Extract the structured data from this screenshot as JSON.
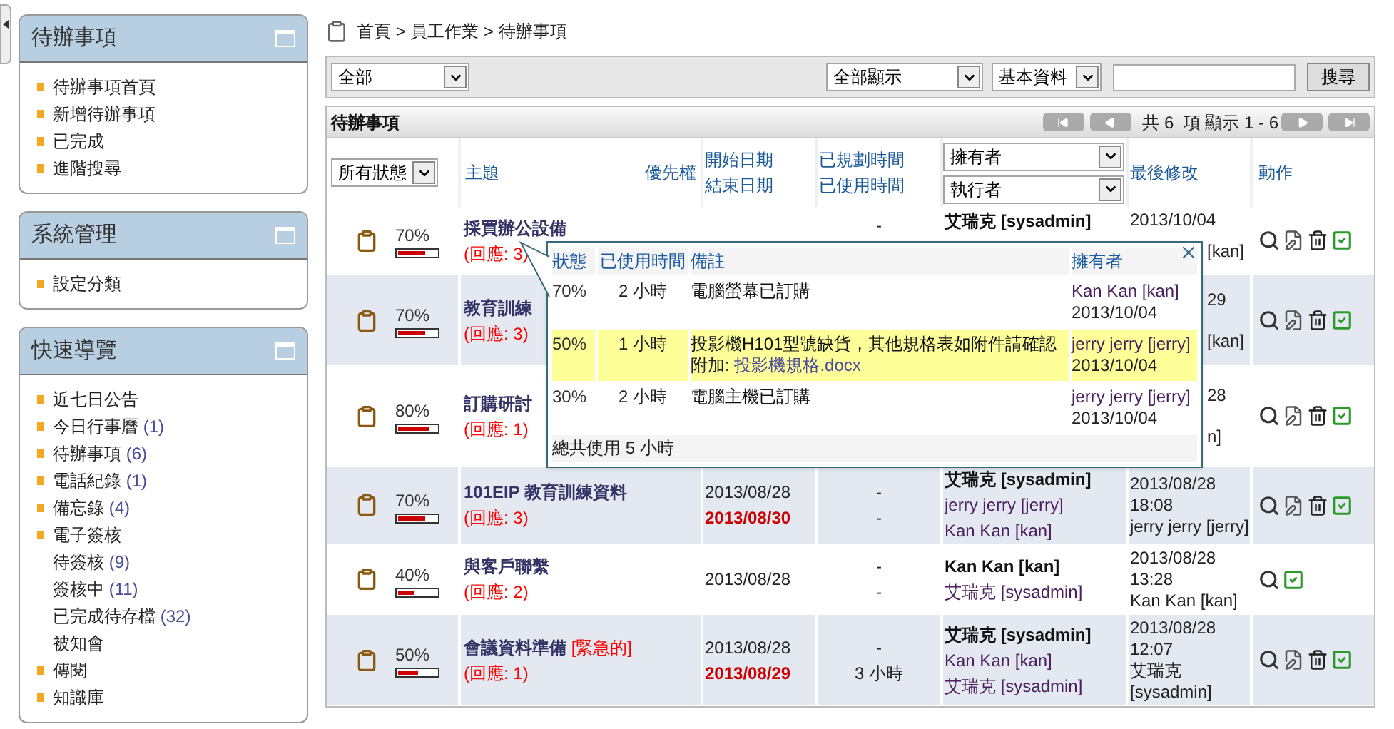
{
  "sidebar": [
    {
      "title": "待辦事項",
      "items": [
        {
          "label": "待辦事項首頁",
          "bullet": true
        },
        {
          "label": "新增待辦事項",
          "bullet": true
        },
        {
          "label": "已完成",
          "bullet": true
        },
        {
          "label": "進階搜尋",
          "bullet": true
        }
      ]
    },
    {
      "title": "系統管理",
      "items": [
        {
          "label": "設定分類",
          "bullet": true
        }
      ]
    },
    {
      "title": "快速導覽",
      "items": [
        {
          "label": "近七日公告",
          "bullet": true
        },
        {
          "label": "今日行事曆",
          "count": "(1)",
          "bullet": true
        },
        {
          "label": "待辦事項",
          "count": "(6)",
          "bullet": true
        },
        {
          "label": "電話紀錄",
          "count": "(1)",
          "bullet": true
        },
        {
          "label": "備忘錄",
          "count": "(4)",
          "bullet": true
        },
        {
          "label": "電子簽核",
          "bullet": true
        },
        {
          "label": "待簽核",
          "count": "(9)",
          "bullet": false
        },
        {
          "label": "簽核中",
          "count": "(11)",
          "bullet": false
        },
        {
          "label": "已完成待存檔",
          "count": "(32)",
          "bullet": false
        },
        {
          "label": "被知會",
          "bullet": false
        },
        {
          "label": "傳閱",
          "bullet": true
        },
        {
          "label": "知識庫",
          "bullet": true
        }
      ]
    }
  ],
  "breadcrumb": "首頁 > 員工作業 > 待辦事項",
  "filter_bar": {
    "category": "全部",
    "display": "全部顯示",
    "field": "基本資料",
    "search_button": "搜尋"
  },
  "list": {
    "title": "待辦事項",
    "pager": "共 6  項 顯示 1 - 6",
    "status_filter": "所有狀態",
    "headers": {
      "subject": "主題",
      "priority": "優先權",
      "start": "開始日期",
      "end": "結束日期",
      "planned": "已規劃時間",
      "used": "已使用時間",
      "owner": "擁有者",
      "assignee": "執行者",
      "modified": "最後修改",
      "actions": "動作"
    },
    "rows": [
      {
        "progress": "70%",
        "level": 0.7,
        "subject": "採買辦公設備",
        "replies": "(回應: 3)",
        "planned": "-",
        "owner": "艾瑞克 [sysadmin]",
        "modified": [
          {
            "text": "2013/10/04"
          },
          {
            "text": "[kan]",
            "kind": "tail"
          }
        ],
        "actions": [
          {
            "kind": "view"
          },
          {
            "kind": "edit"
          },
          {
            "kind": "delete"
          },
          {
            "kind": "done"
          }
        ]
      },
      {
        "progress": "70%",
        "level": 0.7,
        "subject": "教育訓練",
        "replies": "(回應: 3)",
        "modified": [
          {
            "text": "29",
            "kind": "tail"
          },
          {
            "text": "[kan]",
            "kind": "tail"
          }
        ],
        "actions": [
          {
            "kind": "view"
          },
          {
            "kind": "edit"
          },
          {
            "kind": "delete"
          },
          {
            "kind": "done"
          }
        ]
      },
      {
        "progress": "80%",
        "level": 0.8,
        "subject": "訂購研討",
        "replies": "(回應: 1)",
        "modified": [
          {
            "text": "28",
            "kind": "tail"
          },
          {
            "text": "n]",
            "kind": "tail"
          }
        ],
        "actions": [
          {
            "kind": "view"
          },
          {
            "kind": "edit"
          },
          {
            "kind": "delete"
          },
          {
            "kind": "done"
          }
        ]
      },
      {
        "progress": "70%",
        "level": 0.7,
        "subject": "101EIP 教育訓練資料",
        "replies": "(回應: 3)",
        "start": "2013/08/28",
        "end": "2013/08/30",
        "planned": "-",
        "used": "-",
        "owner": "艾瑞克 [sysadmin]",
        "assignees": [
          "jerry jerry [jerry]",
          "Kan Kan [kan]"
        ],
        "modified": [
          {
            "text": "2013/08/28"
          },
          {
            "text": "18:08"
          },
          {
            "text": "jerry jerry [jerry]"
          }
        ],
        "actions": [
          {
            "kind": "view"
          },
          {
            "kind": "edit"
          },
          {
            "kind": "delete"
          },
          {
            "kind": "done"
          }
        ]
      },
      {
        "progress": "40%",
        "level": 0.4,
        "subject": "與客戶聯繫",
        "replies": "(回應: 2)",
        "start": "2013/08/28",
        "planned": "-",
        "used": "-",
        "owner": "Kan Kan [kan]",
        "assignees": [
          "艾瑞克 [sysadmin]"
        ],
        "modified": [
          {
            "text": "2013/08/28"
          },
          {
            "text": "13:28"
          },
          {
            "text": "Kan Kan [kan]"
          }
        ],
        "actions": [
          {
            "kind": "view"
          },
          {
            "kind": "done"
          }
        ]
      },
      {
        "progress": "50%",
        "level": 0.5,
        "subject": "會議資料準備",
        "tag": "[緊急的]",
        "replies": "(回應: 1)",
        "start": "2013/08/28",
        "end": "2013/08/29",
        "planned": "-",
        "used": "3 小時",
        "owner": "艾瑞克 [sysadmin]",
        "assignees": [
          "Kan Kan [kan]",
          "艾瑞克 [sysadmin]"
        ],
        "modified": [
          {
            "text": "2013/08/28"
          },
          {
            "text": "12:07"
          },
          {
            "text": "艾瑞克"
          },
          {
            "text": "[sysadmin]"
          }
        ],
        "actions": [
          {
            "kind": "view"
          },
          {
            "kind": "edit"
          },
          {
            "kind": "delete"
          },
          {
            "kind": "done"
          }
        ]
      }
    ]
  },
  "popup": {
    "headers": [
      "狀態",
      "已使用時間",
      "備註",
      "擁有者"
    ],
    "entries": [
      {
        "status": "70%",
        "used": "2 小時",
        "note": "電腦螢幕已訂購",
        "owner": "Kan Kan [kan]",
        "date": "2013/10/04",
        "highlighted": false
      },
      {
        "status": "50%",
        "used": "1 小時",
        "note": "投影機H101型號缺貨，其他規格表如附件請確認",
        "attachment_label": "附加:",
        "attachment": "投影機規格.docx",
        "owner": "jerry jerry [jerry]",
        "date": "2013/10/04",
        "highlighted": true
      },
      {
        "status": "30%",
        "used": "2 小時",
        "note": "電腦主機已訂購",
        "owner": "jerry jerry [jerry]",
        "date": "2013/10/04",
        "highlighted": false
      }
    ],
    "total": "總共使用 5 小時"
  }
}
